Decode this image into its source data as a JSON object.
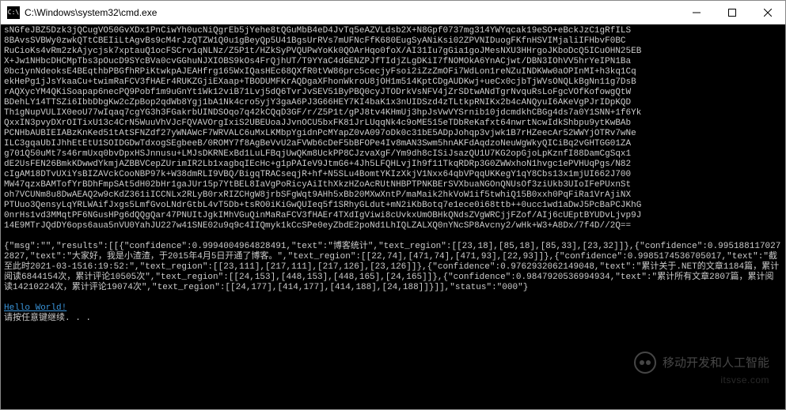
{
  "titlebar": {
    "icon_label": "C:\\",
    "title": "C:\\Windows\\system32\\cmd.exe"
  },
  "console": {
    "blob": "sNGfeJBZ5Dzk3jQCugVO50GvXDx1PnCiwYh0ucNiQgrEb5jYehe8tQGuMbB4eD4JvTq5eAZVLdsb2X+N8Gpf0737mg314YWYqcak19eSO+eBckJzC1gRfILS\n8BAvsSVBWy0zwkQTtCBEIiLtAgvBs9cM4rJzQTZW1Q0u1gBeyQp5U41BgsUrRVs7mUFNcFfK680EugSyANiKsi02ZPVNIDuogFKfnHSVIMjaliIFHbvF0BC\nRuCioKs4vRm2zkAjycjsk7xptauQ1ocFSCrv1qNLNz/Z5P1t/HZkSyPVQUPwYoKk0QOArHqo0foX/AI31Iu7gGia1goJMesNXU3HHrgoJKboDcQ5ICuOHN25EB\nX+Jw1NHbcDHCMpTbs3pOucD9SYcBVa0cvGGhuNJXIOBS9kOs4FrQjhUT/T9YYaC4dGENZPJfTIdjZLgDKiI7fNOMOkA6YnACjwt/DBN3IOhVV5hrYeIPN1Ba\n0bc1ynNdeoksE4BEqthbPBGfhRPiKtwkpAJEAHfrg165WxIQasHEc68QXfR0tVW86prc5cecjyFsoi2iZzZmOFi7WdLon1reNZuINDKWw0aOPInMI+h3kq1Cq\nekHePg1jJsYkaaCu+twimRaFCV3fHAEr4RUKZGjiEXaap+TBODUMFKrAQDgaXFhonWkroU8jOH1m514KptCDgAUDKwj+ueCx0cjbTjWVsONQLkBgNn11g7DsB\nrAQXycYM4QKiSoapap6necPQ9Pobf1m9uGnYt1Wk12viB71Lvj5dQ6TvrJvSEV51ByPBQ0cyJTODrkVsNFV4jZrSDtwANdTgrNvquRsLoFgcVOfKofowgQtW\nBDehLY14TTSZi6IbbDbgKw2cZpBop2qdWb8Ygj1bA1Nk4cro5yjY3gaA6PJ3G66HEY7KI4baK1x3nUIDSzd4zTLtkpRNIKx2b4cANQyuI6AKeVgPJrIDpKQD\nTh1gNupVULIX0eoU77wIqaq7cgYG3h3FGakrbUINDSOqo7q42kCQqD3GF/r/Z5P1t/gPJ8tv4KHmUj3hpJsVwVYSrnib10jdcmdkhCBGg4ds7a0Y1SNN+1f6Yk\nQxxIN3pvyDXrOITixU13c4CrN5WuuVhVJcFQVAVOrgIxiS2UBEUoaJJvnOCU5bxFK81JrLUqqNk4c9oME515eTDbReKafxt64nwrtNcwIdkShbpu9ytKwBAb\nPCNHbAUBIEIABzKnKed51tAtSFNZdf27yWNAWcF7WRVALC6uMxLKMbpYgidnPcMYapZ0vA097oDk0c31bE5ADpJohqp3vjwk1B7rHZeecAr52WWYjOTRv7wNe\nILC3gqaUbIJhhEtEtU1SOIDGDwTdxogSEgbeeB/0ROMY7f8AgBeVvU2aFVWb6cDeF5bBFOPe4Iv8mAN3Swm5hnAKFdAqdzoNeuWgWkyQICiBq2vGHTGG01ZA\ng701Q50uMt7s46rmUxq0bvDpxHSJnnusu+LMJsDKRNExBd1LuLFBqjUwQKm8UckPP8CJzvaXgF/Ym9dh8cISiJsazQU1U7KG2opGjoLpKznfI88DamCgSqx1\ndE2UsFEN26BmkKDwwdYkmjAZBBVCepZUrimIR2Lb1xagbqIEcHc+g1pPAIeV9JtmG6+4Jh5LFQHLvjIh9f11TkqRDRp3G0ZWWxhoN1hvgc1ePVHUqPgs/N82\ncIgAM18DTvUXiYsBIZAVckCooNBP97k+W38dmRLI9VBQ/BigqTRACseqjR+hf+N5SLu4BomtYKIzXkjV1Nxx64qbVPqqUKKegY1qY8Cbs13x1mjUI662J700\nMW47qzxBAMTofYrBDhFmpSAt5dH02bHr1gaJUr15p7YtBEL8IaVgPoRicyAiIthXkzHZoAcRUtNHBPTPNKBErSVXbuaNGOnQNUsOf3ziUkb3UIoIFePUxnSt\noh7VCUNm8u8DwAEAQ2w9cKdZ361iICCNLx2RLyB0rxRIZCHgW8jrbSFgWqt9AHh5xBb20MXwXntP/maMaik2hkVoW1if5twhiQ15B0xxh0PqFiRa1VrAjiNX\nPTUuo3QensyLqYRLWAifJxgs5LmfGvoLNdrGtbL4vT5Db+tsRO0iKiGwQUIeq5f1SRhyGLdut+mN2iKbBotq7e1ece0i68ttb++0ucc1wd1aDwJ5PcBaPCJKhG\n0nrHs1vd3MMqtPF6NGusHPg6dQQgQar47PNUItJgkIMhVGuQinMaRaFCV3fHAEr4TXdIgViwi8cUvkxUmOBHkQNdsZVgWRCjjFZof/AIj6cUEptBYUDvLjvp9J\n14E9MTrJQdDY6ops6aua5nVU0YahJU227w41SNE02u9q9c4IIQmyk1kCcSPe0eyZbdE2poNd1LhIQLZALXQ0nYNcSP8Avcny2/wHk+W3+A8Dx/7f4D//2Q==",
    "json_line1": "{\"msg\":\"\",\"results\":[[{\"confidence\":0.9994004964828491,\"text\":\"博客统计\",\"text_region\":[[23,18],[85,18],[85,33],[23,32]]},{\"confidence\":0.9951881170272827,\"text\":\"大家好，我是小渣渣，于2015年4月5日开通了博客。\",\"text_region\":[[22,74],[471,74],[471,93],[22,93]]},{\"confidence\":0.9985174536705017,\"text\":\"截至此时2021-03-1516:19:52:\",\"text_region\":[[23,111],[217,111],[217,126],[23,126]]},{\"confidence\":0.9762932062149048,\"text\":\"累计关于.NET的文章1184篇，累计阅读6844154次，累计评论10505次\",\"text_region\":[[24,153],[448,153],[448,165],[24,165]]},{\"confidence\":0.9847920536994934,\"text\":\"累计所有文章2807篇，累计阅读14210224次，累计评论19074次\",\"text_region\":[[24,177],[414,177],[414,188],[24,188]]}]],\"status\":\"000\"}",
    "hello": "Hello World!",
    "press_any_key": "请按任意键继续. . ."
  },
  "watermark": {
    "main": "移动开发和人工智能",
    "sub": "itsvse.com"
  }
}
